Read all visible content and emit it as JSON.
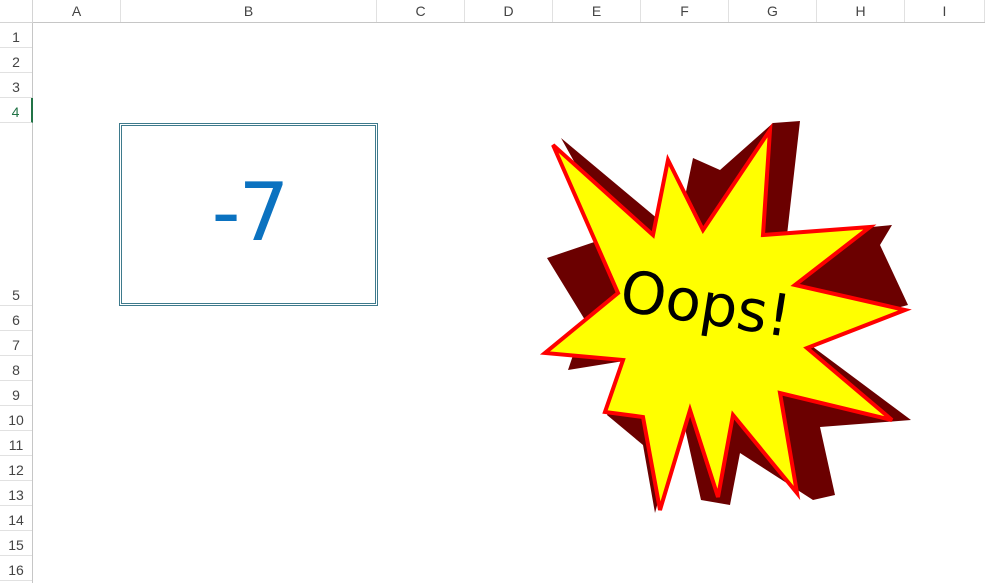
{
  "sheet": {
    "columns": [
      "A",
      "B",
      "C",
      "D",
      "E",
      "F",
      "G",
      "H",
      "I"
    ],
    "rows": [
      "1",
      "2",
      "3",
      "4",
      "5",
      "6",
      "7",
      "8",
      "9",
      "10",
      "11",
      "12",
      "13",
      "14",
      "15",
      "16"
    ],
    "active_row": "4"
  },
  "textbox": {
    "value": "-7"
  },
  "callout": {
    "text": "Oops!",
    "fill_color": "#ffff00",
    "outline_color": "#ff0000",
    "shadow_color": "#6b0000"
  }
}
